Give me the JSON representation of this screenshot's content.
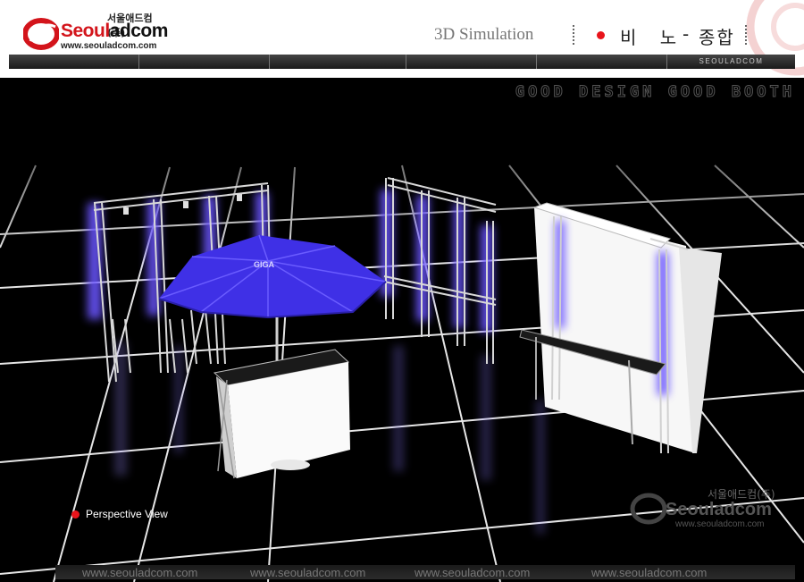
{
  "header": {
    "logo_korean": "서울애드컴(주)",
    "logo_seoul": "Seoul",
    "logo_rest": "adcom",
    "logo_url": "www.seouladcom.com",
    "section_title": "3D Simulation",
    "breadcrumb_1": "비 노",
    "breadcrumb_sep": "-",
    "breadcrumb_2": "종합"
  },
  "nav": {
    "brand_label": "SEOULADCOM"
  },
  "scene": {
    "tagline": "GOOD DESIGN GOOD BOOTH",
    "caption": "Perspective View",
    "umbrella_label": "GIGA"
  },
  "watermark": {
    "korean": "서울애드컴(주)",
    "word": "Seouladcom",
    "url": "www.seouladcom.com"
  },
  "footer": {
    "urls": [
      "www.seouladcom.com",
      "www.seouladcom.com",
      "www.seouladcom.com",
      "www.seouladcom.com"
    ]
  },
  "colors": {
    "brand_red": "#d3141b",
    "umbrella_blue": "#3f30e6",
    "truss_glow": "#7d6bff"
  }
}
